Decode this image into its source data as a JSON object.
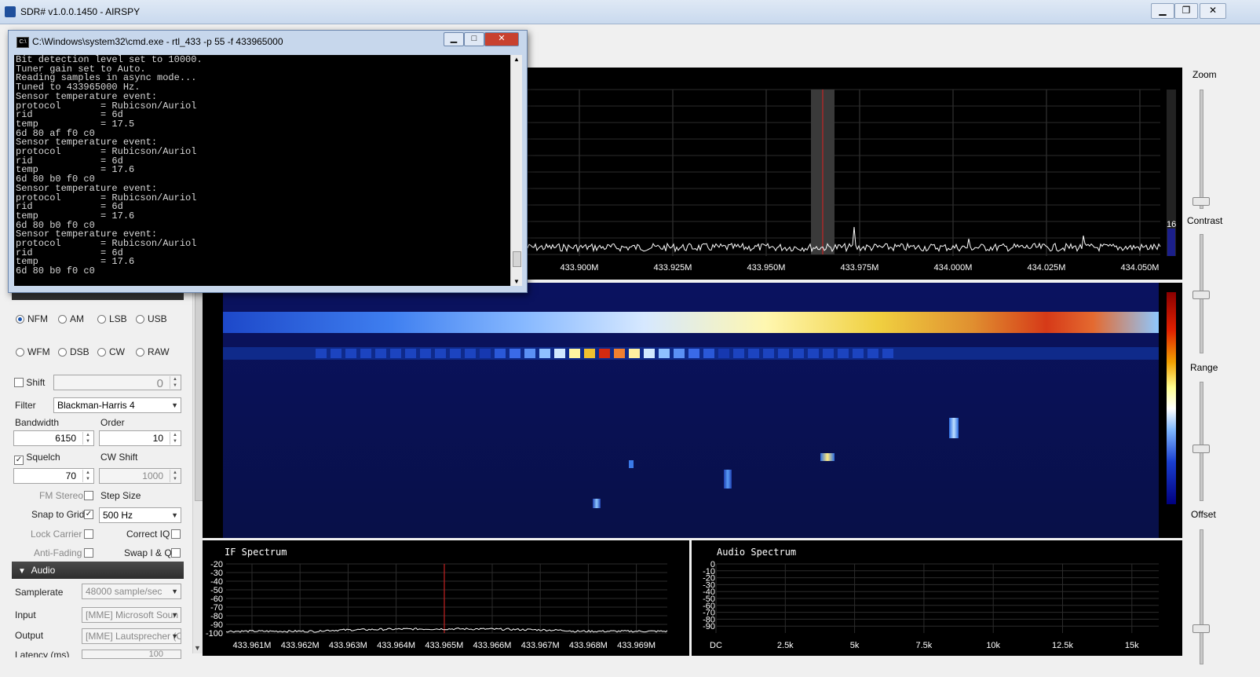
{
  "window": {
    "title": "SDR# v1.0.0.1450 - AIRSPY",
    "minimize": "▁",
    "maximize": "❐",
    "close": "✕"
  },
  "console": {
    "title": "C:\\Windows\\system32\\cmd.exe - rtl_433  -p 55 -f 433965000",
    "lines": "Bit detection level set to 10000.\nTuner gain set to Auto.\nReading samples in async mode...\nTuned to 433965000 Hz.\nSensor temperature event:\nprotocol       = Rubicson/Auriol\nrid            = 6d\ntemp           = 17.5\n6d 80 af f0 c0\nSensor temperature event:\nprotocol       = Rubicson/Auriol\nrid            = 6d\ntemp           = 17.6\n6d 80 b0 f0 c0\nSensor temperature event:\nprotocol       = Rubicson/Auriol\nrid            = 6d\ntemp           = 17.6\n6d 80 b0 f0 c0\nSensor temperature event:\nprotocol       = Rubicson/Auriol\nrid            = 6d\ntemp           = 17.6\n6d 80 b0 f0 c0",
    "minimize": "▁",
    "maximize": "□",
    "close": "✕"
  },
  "radio": {
    "modes_row1": [
      "NFM",
      "AM",
      "LSB",
      "USB"
    ],
    "modes_row2": [
      "WFM",
      "DSB",
      "CW",
      "RAW"
    ],
    "selected": "NFM",
    "shift_label": "Shift",
    "shift_value": "0",
    "filter_label": "Filter",
    "filter_value": "Blackman-Harris 4",
    "bandwidth_label": "Bandwidth",
    "bandwidth_value": "6150",
    "order_label": "Order",
    "order_value": "10",
    "squelch_label": "Squelch",
    "squelch_value": "70",
    "cwshift_label": "CW Shift",
    "cwshift_value": "1000",
    "fmstereo_label": "FM Stereo",
    "stepsize_label": "Step Size",
    "snap_label": "Snap to Grid",
    "step_value": "500 Hz",
    "lockcarrier_label": "Lock Carrier",
    "correctiq_label": "Correct IQ",
    "antifading_label": "Anti-Fading",
    "swapiq_label": "Swap I & Q"
  },
  "audio": {
    "header": "Audio",
    "samplerate_label": "Samplerate",
    "samplerate_value": "48000 sample/sec",
    "input_label": "Input",
    "input_value": "[MME] Microsoft Soun",
    "output_label": "Output",
    "output_value": "[MME] Lautsprecher (C",
    "latency_label": "Latency (ms)",
    "latency_value": "100"
  },
  "spectrum": {
    "freq_labels": [
      "433.900M",
      "433.925M",
      "433.950M",
      "433.975M",
      "434.000M",
      "434.025M",
      "434.050M"
    ],
    "scale_value": "16"
  },
  "if_spectrum": {
    "title": "IF Spectrum",
    "y_labels": [
      "-20",
      "-30",
      "-40",
      "-50",
      "-60",
      "-70",
      "-80",
      "-90",
      "-100"
    ],
    "x_labels": [
      "433.961M",
      "433.962M",
      "433.963M",
      "433.964M",
      "433.965M",
      "433.966M",
      "433.967M",
      "433.968M",
      "433.969M"
    ]
  },
  "audio_spectrum": {
    "title": "Audio Spectrum",
    "y_labels": [
      "0",
      "-10",
      "-20",
      "-30",
      "-40",
      "-50",
      "-60",
      "-70",
      "-80",
      "-90"
    ],
    "x_labels": [
      "DC",
      "2.5k",
      "5k",
      "7.5k",
      "10k",
      "12.5k",
      "15k"
    ]
  },
  "right_panel": {
    "zoom_label": "Zoom",
    "contrast_label": "Contrast",
    "range_label": "Range",
    "offset_label": "Offset"
  },
  "colors": {
    "accent": "#1a55b0",
    "spectrum_line": "#ffffff",
    "center_marker": "#e02020"
  }
}
